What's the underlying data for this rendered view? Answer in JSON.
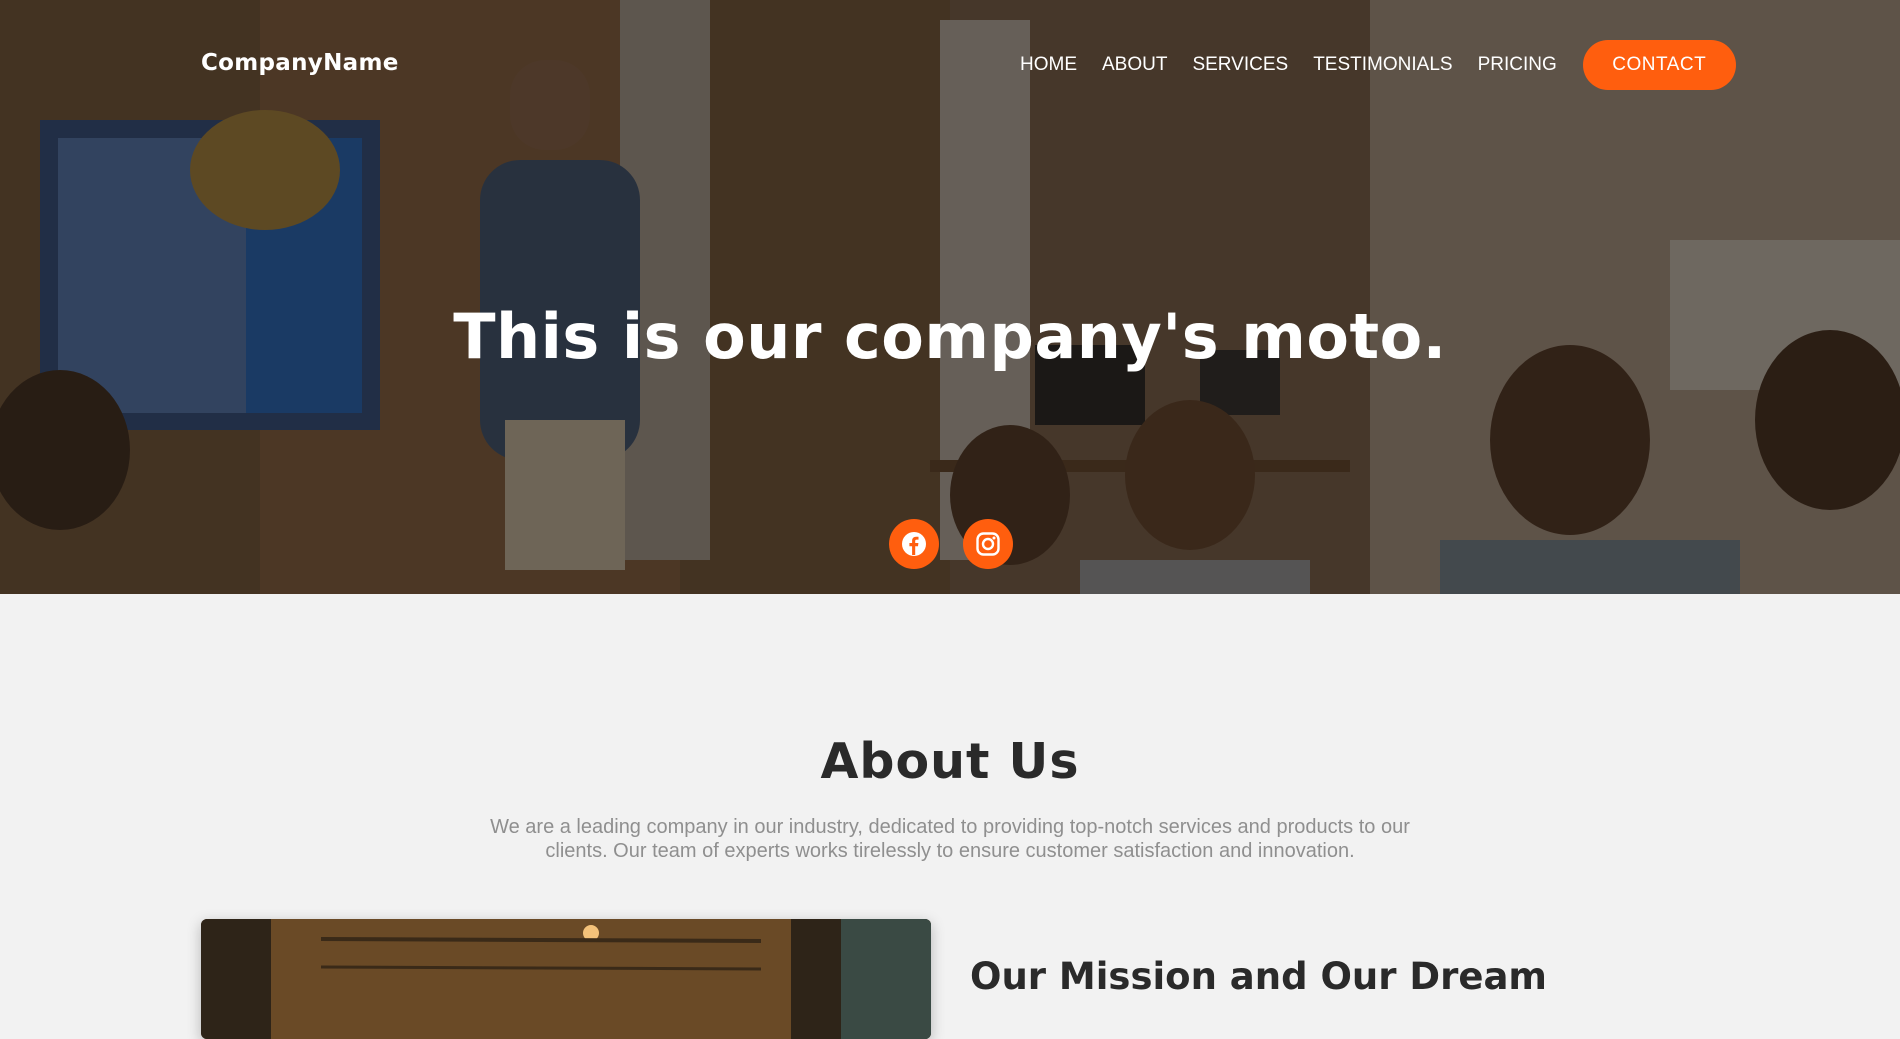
{
  "nav": {
    "brand": "CompanyName",
    "links": [
      "HOME",
      "ABOUT",
      "SERVICES",
      "TESTIMONIALS",
      "PRICING"
    ],
    "contact_label": "CONTACT"
  },
  "hero": {
    "title": "This is our company's moto.",
    "social_icons": [
      "facebook-icon",
      "instagram-icon"
    ]
  },
  "about": {
    "title": "About Us",
    "text": "We are a leading company in our industry, dedicated to providing top-notch services and products to our clients. Our team of experts works tirelessly to ensure customer satisfaction and innovation.",
    "mission_title": "Our Mission and Our Dream"
  },
  "colors": {
    "accent": "#ff5e0e",
    "heading": "#2a2a2a",
    "body_text": "#8f8f8f",
    "background": "#f2f2f2"
  }
}
